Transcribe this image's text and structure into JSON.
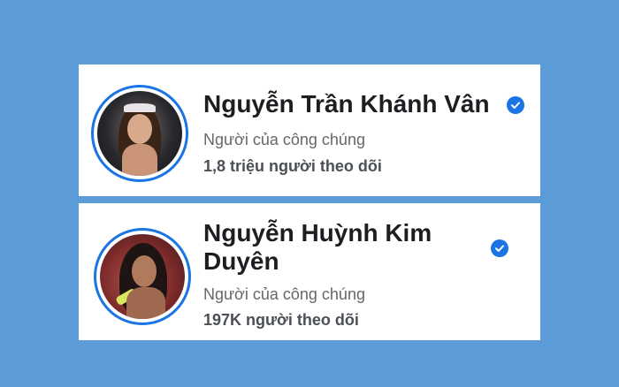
{
  "colors": {
    "background": "#5b9bd8",
    "accent": "#1b74e4",
    "name": "#1c1e21",
    "subtext": "#65676b"
  },
  "profiles": [
    {
      "name": "Nguyễn Trần Khánh Vân",
      "verified_icon": "verified-check-icon",
      "category": "Người của công chúng",
      "followers": "1,8 triệu người theo dõi"
    },
    {
      "name": "Nguyễn Huỳnh Kim Duyên",
      "verified_icon": "verified-check-icon",
      "category": "Người của công chúng",
      "followers": "197K người theo dõi"
    }
  ]
}
